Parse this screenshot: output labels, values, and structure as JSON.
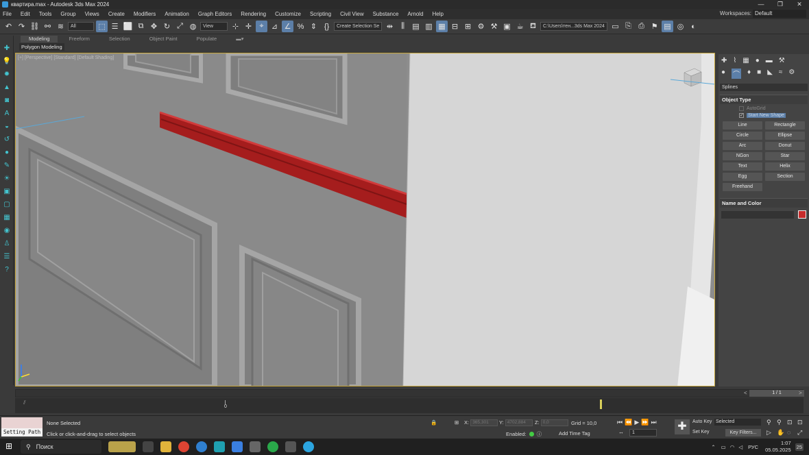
{
  "window": {
    "title": "квартира.max - Autodesk 3ds Max 2024",
    "controls": [
      "—",
      "❐",
      "✕"
    ]
  },
  "menu": {
    "items": [
      "File",
      "Edit",
      "Tools",
      "Group",
      "Views",
      "Create",
      "Modifiers",
      "Animation",
      "Graph Editors",
      "Rendering",
      "Customize",
      "Scripting",
      "Civil View",
      "Substance",
      "Arnold",
      "Help"
    ],
    "workspaces_label": "Workspaces:",
    "workspaces_value": "Default"
  },
  "toolbar": {
    "filter": "All",
    "refcoord": "View",
    "selection_set": "Create Selection Se",
    "path": "C:\\Users\\тен...3ds Max 2024"
  },
  "ribbon": {
    "tabs": [
      "Modeling",
      "Freeform",
      "Selection",
      "Object Paint",
      "Populate"
    ],
    "active_tab": "Modeling",
    "sub": "Polygon Modeling"
  },
  "viewport": {
    "label": "[+] [Perspective] [Standard] [Default Shading]"
  },
  "command_panel": {
    "category": "Splines",
    "object_type_title": "Object Type",
    "autogrid": "AutoGrid",
    "start_new_shape": "Start New Shape",
    "buttons": [
      "Line",
      "Rectangle",
      "Circle",
      "Ellipse",
      "Arc",
      "Donut",
      "NGon",
      "Star",
      "Text",
      "Helix",
      "Egg",
      "Section",
      "Freehand"
    ],
    "name_color_title": "Name and Color",
    "color": "#c72c2c"
  },
  "timeline": {
    "position": "1 / 1",
    "start": "0"
  },
  "status": {
    "maxscript": "Setting Path",
    "selection": "None Selected",
    "prompt": "Click or click-and-drag to select objects",
    "x_label": "X:",
    "x_value": "365,301",
    "y_label": "Y:",
    "y_value": "4702,884",
    "z_label": "Z:",
    "z_value": "0,0",
    "grid": "Grid = 10,0",
    "enabled": "Enabled:",
    "add_time_tag": "Add Time Tag",
    "frame": "1",
    "auto_key": "Auto Key",
    "set_key": "Set Key",
    "selected": "Selected",
    "key_filters": "Key Filters..."
  },
  "taskbar": {
    "search": "Поиск",
    "lang": "РУС",
    "time": "1:07",
    "date": "05.05.2025",
    "badge": "25"
  }
}
